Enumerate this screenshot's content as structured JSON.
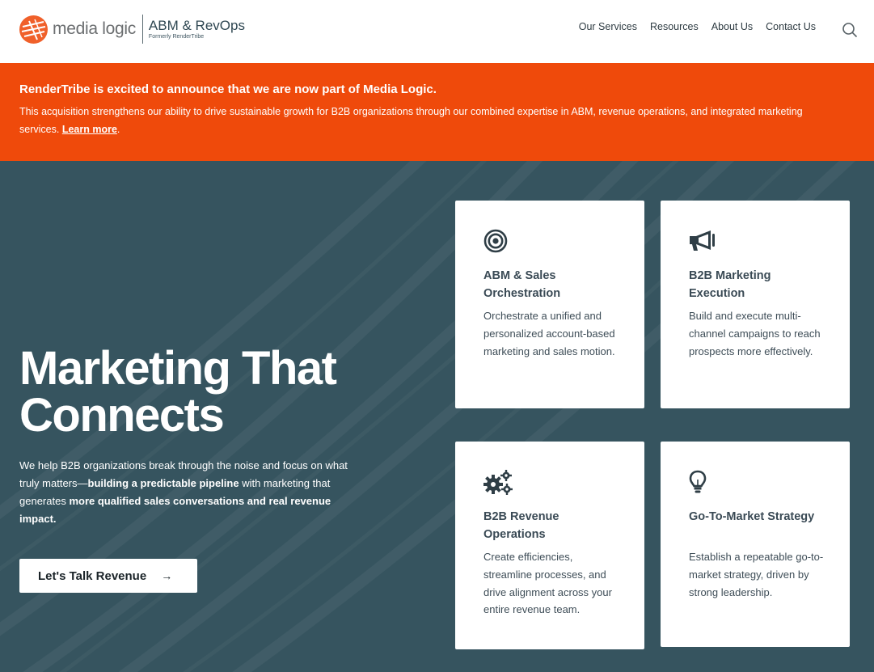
{
  "header": {
    "logo_word": "media logic",
    "logo_title": "ABM & RevOps",
    "logo_subtitle": "Formerly RenderTribe",
    "nav": [
      "Our Services",
      "Resources",
      "About Us",
      "Contact Us"
    ],
    "search_icon": "search-icon"
  },
  "banner": {
    "headline": "RenderTribe is excited to announce that we are now part of Media Logic.",
    "body": "This acquisition strengthens our ability to drive sustainable growth for B2B organizations through our combined expertise in ABM, revenue operations, and integrated marketing services.",
    "link": "Learn more",
    "suffix": ".",
    "background": "#ef4a0b"
  },
  "hero": {
    "title_line1": "Marketing That",
    "title_line2": "Connects",
    "desc_1": "We help B2B organizations break through the noise and focus on what truly matters—",
    "desc_bold_1": "building a predictable pipeline",
    "desc_2": " with marketing that generates ",
    "desc_bold_2": "more qualified sales conversations and real revenue impact.",
    "cta_label": "Let's Talk Revenue",
    "cta_arrow": "→",
    "background": "#36545f"
  },
  "cards": [
    {
      "icon": "target-icon",
      "title": "ABM & Sales Orchestration",
      "text": "Orchestrate a unified and personalized account-based marketing and sales motion."
    },
    {
      "icon": "megaphone-icon",
      "title": "B2B Marketing Execution",
      "text": "Build and execute multi-channel campaigns to reach prospects more effectively."
    },
    {
      "icon": "gears-icon",
      "title": "B2B Revenue Operations",
      "text": "Create efficiencies, streamline processes, and drive alignment across your entire revenue team."
    },
    {
      "icon": "lightbulb-icon",
      "title": "Go-To-Market Strategy",
      "text": "Establish a repeatable go-to-market strategy, driven by strong leadership."
    }
  ]
}
